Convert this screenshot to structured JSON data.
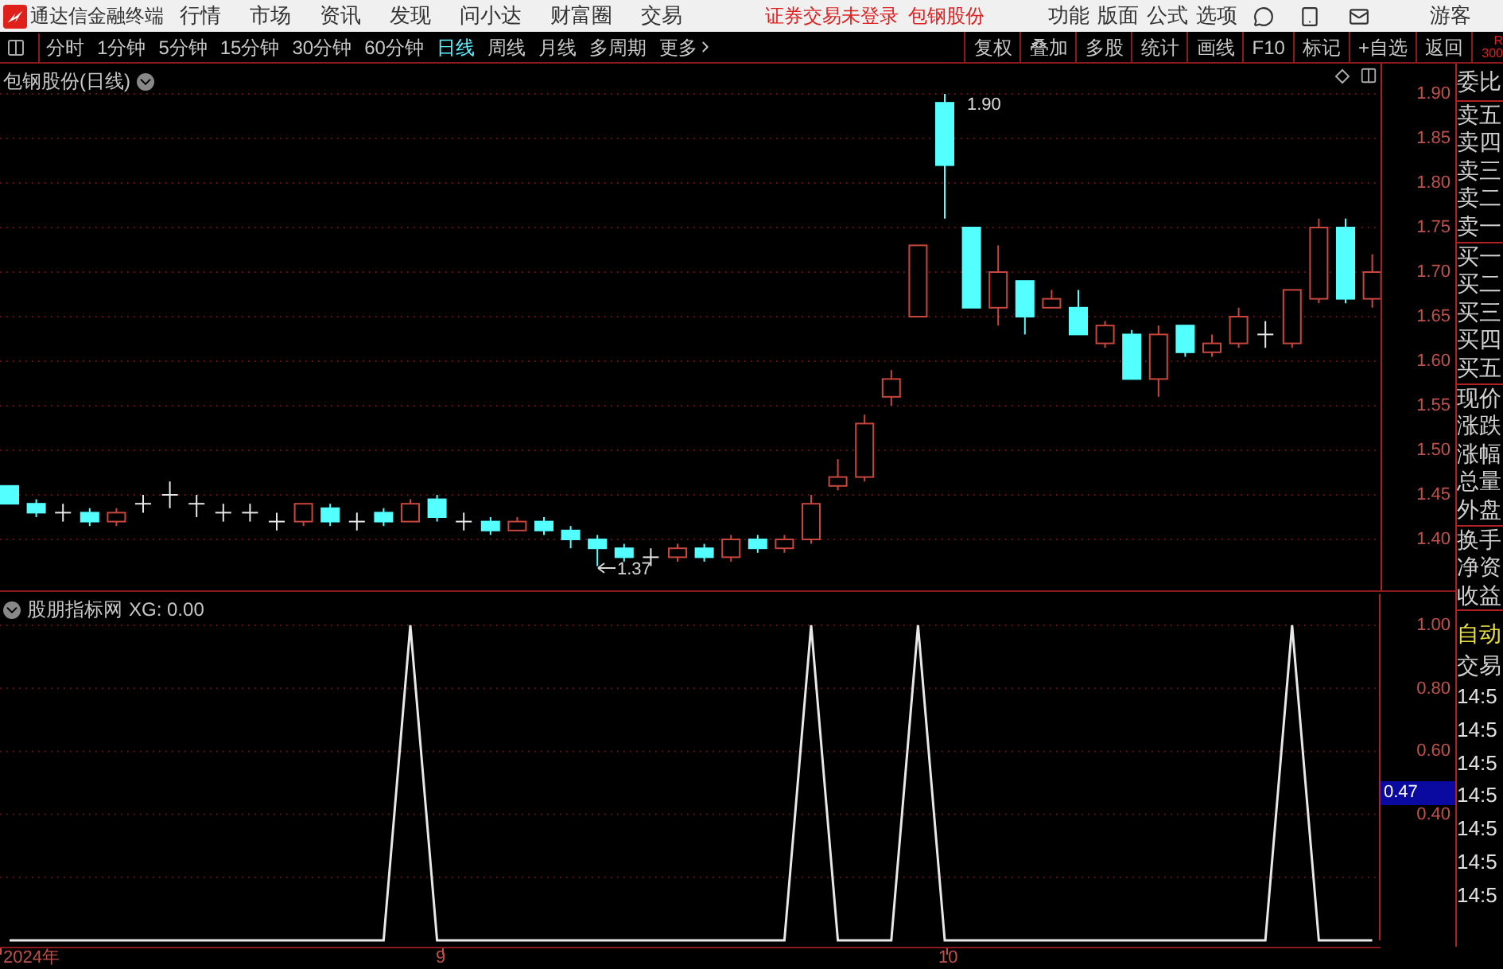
{
  "top_bar": {
    "app_title": "通达信金融终端",
    "menus": [
      "行情",
      "市场",
      "资讯",
      "发现",
      "问小达",
      "财富圈",
      "交易"
    ],
    "status": [
      "证券交易未登录",
      "包钢股份"
    ],
    "tools": [
      "功能",
      "版面",
      "公式",
      "选项"
    ],
    "user": "游客"
  },
  "period_tabs": [
    {
      "label": "分时",
      "selected": false
    },
    {
      "label": "1分钟",
      "selected": false
    },
    {
      "label": "5分钟",
      "selected": false
    },
    {
      "label": "15分钟",
      "selected": false
    },
    {
      "label": "30分钟",
      "selected": false
    },
    {
      "label": "60分钟",
      "selected": false
    },
    {
      "label": "日线",
      "selected": true
    },
    {
      "label": "周线",
      "selected": false
    },
    {
      "label": "月线",
      "selected": false
    },
    {
      "label": "多周期",
      "selected": false
    },
    {
      "label": "更多",
      "selected": false
    }
  ],
  "toolbar_buttons": [
    "复权",
    "叠加",
    "多股",
    "统计",
    "画线",
    "F10",
    "标记",
    "+自选",
    "返回"
  ],
  "corner_label": [
    "R",
    "300"
  ],
  "price_chart": {
    "title": "包钢股份(日线)",
    "high_label": "1.90",
    "low_label": "1.37",
    "axis": [
      "1.90",
      "1.85",
      "1.80",
      "1.75",
      "1.70",
      "1.65",
      "1.60",
      "1.55",
      "1.50",
      "1.45",
      "1.40"
    ]
  },
  "indicator": {
    "title": "股朋指标网",
    "reading": ": 0.00",
    "cursor_value": "0.47",
    "chart_data": {
      "type": "line",
      "ylim": [
        0,
        1.1
      ],
      "grid": true,
      "yticks": [
        {
          "value": 0.4,
          "label": "0.40"
        },
        {
          "value": 0.6,
          "label": "0.60"
        },
        {
          "value": 0.8,
          "label": "0.80"
        },
        {
          "value": 1.0,
          "label": "1.00"
        }
      ],
      "series": [
        {
          "name": "XG",
          "color": "#e8e8e8",
          "values": [
            0,
            0,
            0,
            0,
            0,
            0,
            0,
            0,
            0,
            0,
            0,
            0,
            0,
            0,
            0,
            1,
            0,
            0,
            0,
            0,
            0,
            0,
            0,
            0,
            0,
            0,
            0,
            0,
            0,
            0,
            1,
            0,
            0,
            0,
            1,
            0,
            0,
            0,
            0,
            0,
            0,
            0,
            0,
            0,
            0,
            0,
            0,
            0,
            1,
            0,
            0,
            0
          ]
        }
      ]
    }
  },
  "date_axis": [
    "2024年",
    "9",
    "10"
  ],
  "quote_panel": {
    "groups": [
      [
        "委比"
      ],
      [
        "卖五",
        "卖四",
        "卖三",
        "卖二",
        "卖一"
      ],
      [
        "买一",
        "买二",
        "买三",
        "买四",
        "买五"
      ],
      [
        "现价",
        "涨跌",
        "涨幅",
        "总量",
        "外盘"
      ],
      [
        "换手",
        "净资",
        "收益"
      ]
    ],
    "mode": "自动",
    "trade_title": "交易",
    "times": [
      "14:5",
      "14:5",
      "14:5",
      "14:5",
      "14:5",
      "14:5",
      "14:5"
    ]
  }
}
